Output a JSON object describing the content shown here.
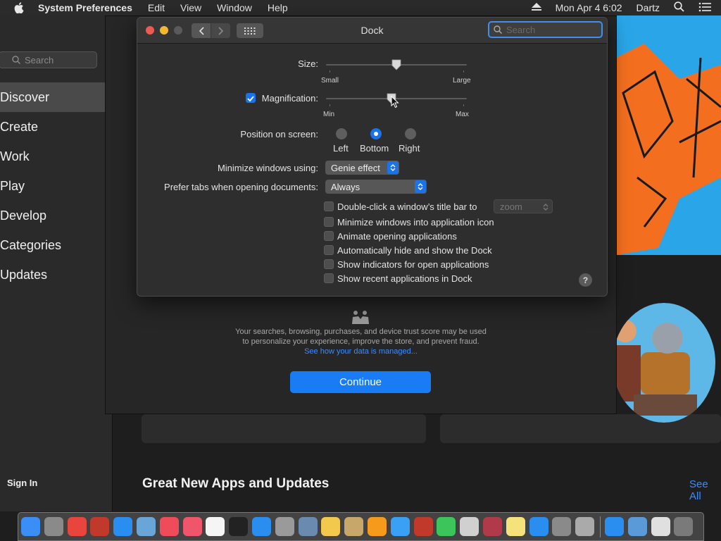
{
  "menubar": {
    "app_name": "System Preferences",
    "items": [
      "Edit",
      "View",
      "Window",
      "Help"
    ],
    "clock": "Mon Apr 4  6:02",
    "user": "Dartz"
  },
  "store": {
    "search_placeholder": "Search",
    "nav": [
      "Discover",
      "Create",
      "Work",
      "Play",
      "Develop",
      "Categories",
      "Updates"
    ],
    "active_nav": "Discover",
    "sign_in": "Sign In",
    "section_title": "Great New Apps and Updates",
    "see_all": "See All",
    "privacy_text_1": "Your searches, browsing, purchases, and device trust score may be used",
    "privacy_text_2": "to personalize your experience, improve the store, and prevent fraud.",
    "privacy_link": "See how your data is managed...",
    "continue_label": "Continue"
  },
  "window": {
    "title": "Dock",
    "search_placeholder": "Search",
    "size": {
      "label": "Size:",
      "min_label": "Small",
      "max_label": "Large",
      "value": 0.5
    },
    "magnification": {
      "label": "Magnification:",
      "checked": true,
      "min_label": "Min",
      "max_label": "Max",
      "value": 0.46
    },
    "position": {
      "label": "Position on screen:",
      "options": [
        "Left",
        "Bottom",
        "Right"
      ],
      "selected": "Bottom"
    },
    "minimize": {
      "label": "Minimize windows using:",
      "value": "Genie effect"
    },
    "prefer_tabs": {
      "label": "Prefer tabs when opening documents:",
      "value": "Always"
    },
    "double_click": {
      "label": "Double-click a window’s title bar to",
      "value": "zoom",
      "checked": false
    },
    "checkboxes": [
      {
        "label": "Minimize windows into application icon",
        "checked": false
      },
      {
        "label": "Animate opening applications",
        "checked": false
      },
      {
        "label": "Automatically hide and show the Dock",
        "checked": false
      },
      {
        "label": "Show indicators for open applications",
        "checked": false
      },
      {
        "label": "Show recent applications in Dock",
        "checked": false
      }
    ],
    "help": "?"
  },
  "dock": {
    "icons": [
      {
        "name": "finder-icon",
        "color": "#3b8ef5"
      },
      {
        "name": "launchpad-icon",
        "color": "#8a8a8a"
      },
      {
        "name": "chrome-icon",
        "color": "#e8453c"
      },
      {
        "name": "flashcard-icon",
        "color": "#c0392b"
      },
      {
        "name": "safari-icon",
        "color": "#2a8ef0"
      },
      {
        "name": "preview-icon",
        "color": "#6aa5d8"
      },
      {
        "name": "news-icon",
        "color": "#f04b5a"
      },
      {
        "name": "music-icon",
        "color": "#f0566b"
      },
      {
        "name": "calendar-icon",
        "color": "#f5f5f5"
      },
      {
        "name": "stocks-icon",
        "color": "#222222"
      },
      {
        "name": "wifi-icon",
        "color": "#2a8ef0"
      },
      {
        "name": "font-book-icon",
        "color": "#9a9a9a"
      },
      {
        "name": "xcode-icon",
        "color": "#6a8ab0"
      },
      {
        "name": "sketch-icon",
        "color": "#f2c94c"
      },
      {
        "name": "notebook-icon",
        "color": "#c8a86a"
      },
      {
        "name": "books-icon",
        "color": "#f59a1a"
      },
      {
        "name": "messages-icon",
        "color": "#3aa0f5"
      },
      {
        "name": "photo-booth-icon",
        "color": "#c0392b"
      },
      {
        "name": "facetime-icon",
        "color": "#3cc55a"
      },
      {
        "name": "quick-note-icon",
        "color": "#d0d0d0"
      },
      {
        "name": "dictionary-icon",
        "color": "#b0394a"
      },
      {
        "name": "notes-icon",
        "color": "#f5e27a"
      },
      {
        "name": "app-store-icon",
        "color": "#2a8ef0"
      },
      {
        "name": "system-preferences-icon",
        "color": "#8a8a8a"
      },
      {
        "name": "script-editor-icon",
        "color": "#aaaaaa"
      },
      {
        "name": "app-store-2-icon",
        "color": "#2a8ef0"
      },
      {
        "name": "downloads-icon",
        "color": "#5a9ad8"
      },
      {
        "name": "printer-icon",
        "color": "#e0e0e0"
      },
      {
        "name": "trash-icon",
        "color": "#7a7a7a"
      }
    ]
  }
}
